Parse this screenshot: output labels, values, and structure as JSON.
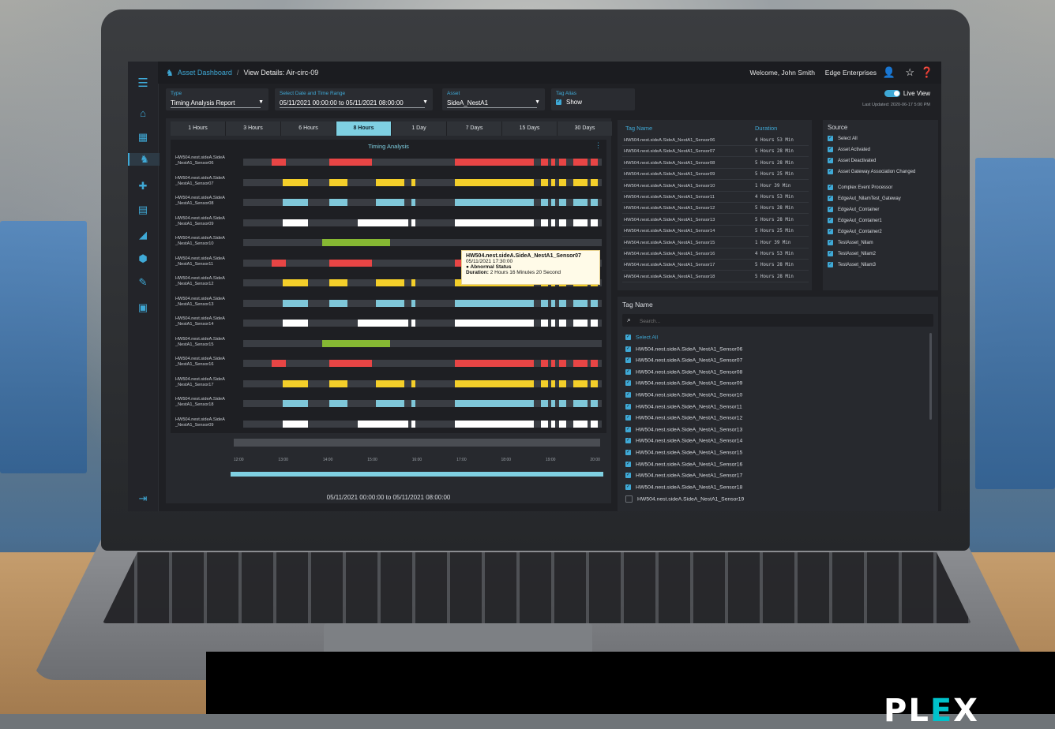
{
  "header": {
    "breadcrumb_root": "Asset Dashboard",
    "breadcrumb_sep": "/",
    "breadcrumb_current": "View Details: Air-circ-09",
    "welcome": "Welcome, John Smith",
    "org": "Edge Enterprises"
  },
  "filters": {
    "type_label": "Type",
    "type_value": "Timing Analysis Report",
    "date_label": "Select Date and Time Range",
    "date_value": "05/11/2021 00:00:00 to 05/11/2021 08:00:00",
    "asset_label": "Asset",
    "asset_value": "SideA_NestA1",
    "tagalias_label": "Tag Alias",
    "tagalias_value": "Show"
  },
  "live_view": {
    "label": "Live View",
    "enabled": true,
    "updated": "Last Updated: 2020-06-17 5:00 PM"
  },
  "timing": {
    "tabs": [
      "1 Hours",
      "3 Hours",
      "6 Hours",
      "8 Hours",
      "1 Day",
      "7 Days",
      "15 Days",
      "30 Days"
    ],
    "active_tab": "8 Hours",
    "title": "Timing Analysis",
    "rows": [
      {
        "label": "HW504.nest.sideA.SideA _NestA1_Sensor06",
        "color": "#e84545"
      },
      {
        "label": "HW504.nest.sideA.SideA _NestA1_Sensor07",
        "color": "#f4cf2a"
      },
      {
        "label": "HW504.nest.sideA.SideA _NestA1_Sensor08",
        "color": "#7fc7d9"
      },
      {
        "label": "HW504.nest.sideA.SideA _NestA1_Sensor09",
        "color": "#ffffff"
      },
      {
        "label": "HW504.nest.sideA.SideA _NestA1_Sensor10",
        "color": "#86b833"
      },
      {
        "label": "HW504.nest.sideA.SideA _NestA1_Sensor11",
        "color": "#e84545"
      },
      {
        "label": "HW504.nest.sideA.SideA _NestA1_Sensor12",
        "color": "#f4cf2a"
      },
      {
        "label": "HW504.nest.sideA.SideA _NestA1_Sensor13",
        "color": "#7fc7d9"
      },
      {
        "label": "HW504.nest.sideA.SideA _NestA1_Sensor14",
        "color": "#ffffff"
      },
      {
        "label": "HW504.nest.sideA.SideA _NestA1_Sensor15",
        "color": "#86b833"
      },
      {
        "label": "HW504.nest.sideA.SideA _NestA1_Sensor16",
        "color": "#e84545"
      },
      {
        "label": "HW504.nest.sideA.SideA _NestA1_Sensor17",
        "color": "#f4cf2a"
      },
      {
        "label": "HW504.nest.sideA.SideA _NestA1_Sensor18",
        "color": "#7fc7d9"
      },
      {
        "label": "HW504.nest.sideA.SideA _NestA1_Sensor09",
        "color": "#ffffff"
      }
    ],
    "tooltip": {
      "title": "HW504.nest.sideA.SideA_NestA1_Sensor07",
      "time": "05/11/2021 17:30:00",
      "status": "Abnormal Status",
      "duration_label": "Duration:",
      "duration_value": "2 Hours 16 Minutes 20 Second"
    },
    "nav_ticks": [
      "12:00",
      "13:00",
      "14:00",
      "15:00",
      "16:00",
      "17:00",
      "18:00",
      "19:00",
      "20:00"
    ],
    "range_label": "05/11/2021 00:00:00 to 05/11/2021 08:00:00"
  },
  "tag_table": {
    "col_name": "Tag Name",
    "col_duration": "Duration",
    "rows": [
      {
        "name": "HW504.nest.sideA.SideA_NestA1_Sensor06",
        "duration": "4 Hours 53 Min"
      },
      {
        "name": "HW504.nest.sideA.SideA_NestA1_Sensor07",
        "duration": "5 Hours 28 Min"
      },
      {
        "name": "HW504.nest.sideA.SideA_NestA1_Sensor08",
        "duration": "5 Hours 28 Min"
      },
      {
        "name": "HW504.nest.sideA.SideA_NestA1_Sensor09",
        "duration": "5 Hours 25 Min"
      },
      {
        "name": "HW504.nest.sideA.SideA_NestA1_Sensor10",
        "duration": "1 Hour 39 Min"
      },
      {
        "name": "HW504.nest.sideA.SideA_NestA1_Sensor11",
        "duration": "4 Hours 53 Min"
      },
      {
        "name": "HW504.nest.sideA.SideA_NestA1_Sensor12",
        "duration": "5 Hours 28 Min"
      },
      {
        "name": "HW504.nest.sideA.SideA_NestA1_Sensor13",
        "duration": "5 Hours 28 Min"
      },
      {
        "name": "HW504.nest.sideA.SideA_NestA1_Sensor14",
        "duration": "5 Hours 25 Min"
      },
      {
        "name": "HW504.nest.sideA.SideA_NestA1_Sensor15",
        "duration": "1 Hour 39 Min"
      },
      {
        "name": "HW504.nest.sideA.SideA_NestA1_Sensor16",
        "duration": "4 Hours 53 Min"
      },
      {
        "name": "HW504.nest.sideA.SideA_NestA1_Sensor17",
        "duration": "5 Hours 28 Min"
      },
      {
        "name": "HW504.nest.sideA.SideA_NestA1_Sensor18",
        "duration": "5 Hours 28 Min"
      }
    ]
  },
  "source": {
    "title": "Source",
    "items": [
      "Select All",
      "Asset Activated",
      "Asset Deactivated",
      "Asset Gateway Association Changed",
      "Complex Event Processor",
      "EdgeAut_NilamTest_Gateway",
      "EdgeAut_Container",
      "EdgeAut_Container1",
      "EdgeAut_Container2",
      "TestAsset_Nilam",
      "TestAsset_Nilam2",
      "TestAsset_Nilam3"
    ]
  },
  "tag_list": {
    "title": "Tag Name",
    "search_placeholder": "Search...",
    "items": [
      "Select All",
      "HW504.nest.sideA.SideA_NestA1_Sensor06",
      "HW504.nest.sideA.SideA_NestA1_Sensor07",
      "HW504.nest.sideA.SideA_NestA1_Sensor08",
      "HW504.nest.sideA.SideA_NestA1_Sensor09",
      "HW504.nest.sideA.SideA_NestA1_Sensor10",
      "HW504.nest.sideA.SideA_NestA1_Sensor11",
      "HW504.nest.sideA.SideA_NestA1_Sensor12",
      "HW504.nest.sideA.SideA_NestA1_Sensor13",
      "HW504.nest.sideA.SideA_NestA1_Sensor14",
      "HW504.nest.sideA.SideA_NestA1_Sensor15",
      "HW504.nest.sideA.SideA_NestA1_Sensor16",
      "HW504.nest.sideA.SideA_NestA1_Sensor17",
      "HW504.nest.sideA.SideA_NestA1_Sensor18",
      "HW504.nest.sideA.SideA_NestA1_Sensor19"
    ],
    "checked_count": 14
  },
  "branding": {
    "logo_p": "PL",
    "logo_e": "E",
    "logo_x": "X"
  },
  "colors": {
    "accent": "#3fa9d6",
    "tab_active": "#7fd0e2",
    "red": "#e84545",
    "yellow": "#f4cf2a",
    "cyan": "#7fc7d9",
    "green": "#86b833"
  }
}
